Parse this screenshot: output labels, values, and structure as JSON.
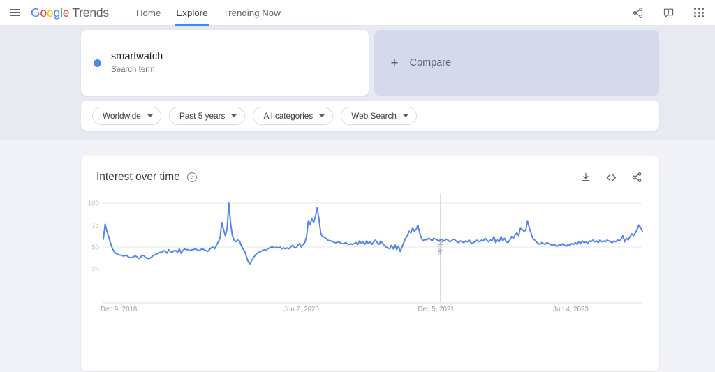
{
  "header": {
    "menu_icon": "hamburger-icon",
    "logo": {
      "g1": "G",
      "g2": "o",
      "g3": "o",
      "g4": "g",
      "g5": "l",
      "g6": "e",
      "product": "Trends"
    },
    "nav": [
      {
        "label": "Home",
        "active": false
      },
      {
        "label": "Explore",
        "active": true
      },
      {
        "label": "Trending Now",
        "active": false
      }
    ],
    "actions": [
      {
        "name": "share-icon",
        "label": "Share"
      },
      {
        "name": "feedback-icon",
        "label": "Send feedback"
      },
      {
        "name": "apps-grid-icon",
        "label": "Google apps"
      }
    ]
  },
  "terms": {
    "card": {
      "title": "smartwatch",
      "subtitle": "Search term",
      "color": "#5585ec"
    },
    "compare": {
      "label": "Compare",
      "icon": "plus-icon"
    }
  },
  "filters": [
    {
      "name": "location-filter",
      "label": "Worldwide"
    },
    {
      "name": "time-range-filter",
      "label": "Past 5 years"
    },
    {
      "name": "category-filter",
      "label": "All categories"
    },
    {
      "name": "search-type-filter",
      "label": "Web Search"
    }
  ],
  "interest_over_time": {
    "title": "Interest over time",
    "help": "?",
    "actions": [
      {
        "name": "download-icon",
        "label": "Download CSV"
      },
      {
        "name": "embed-code-icon",
        "label": "Embed"
      },
      {
        "name": "share-icon",
        "label": "Share"
      }
    ]
  },
  "chart_data": {
    "type": "line",
    "title": "Interest over time",
    "xlabel": "",
    "ylabel": "",
    "ylim": [
      0,
      100
    ],
    "yticks": [
      100,
      75,
      50,
      25
    ],
    "xticks": [
      "Dec 9, 2018",
      "Jun 7, 2020",
      "Dec 5, 2021",
      "Jun 4, 2023"
    ],
    "grid": true,
    "legend": false,
    "line_color": "#5585ec",
    "series_name": "smartwatch",
    "annotations": [
      {
        "label": "Note",
        "x_fraction": 0.625
      }
    ],
    "values": [
      59,
      76,
      68,
      62,
      55,
      49,
      45,
      43,
      42,
      41,
      41,
      40,
      40,
      41,
      39,
      38,
      38,
      39,
      40,
      39,
      37,
      38,
      41,
      40,
      38,
      37,
      37,
      38,
      40,
      41,
      42,
      43,
      44,
      44,
      46,
      45,
      43,
      47,
      45,
      44,
      46,
      46,
      44,
      48,
      43,
      46,
      48,
      47,
      47,
      46,
      47,
      47,
      48,
      47,
      46,
      47,
      48,
      47,
      46,
      45,
      47,
      49,
      50,
      48,
      52,
      56,
      60,
      78,
      70,
      63,
      70,
      100,
      77,
      63,
      58,
      56,
      58,
      57,
      52,
      48,
      45,
      39,
      33,
      31,
      35,
      38,
      41,
      43,
      44,
      45,
      46,
      47,
      46,
      48,
      49,
      50,
      50,
      49,
      50,
      49,
      50,
      48,
      49,
      48,
      49,
      48,
      50,
      52,
      50,
      49,
      52,
      54,
      50,
      53,
      55,
      62,
      80,
      76,
      82,
      78,
      85,
      95,
      82,
      66,
      62,
      61,
      60,
      58,
      57,
      57,
      56,
      55,
      55,
      56,
      55,
      54,
      54,
      55,
      54,
      53,
      54,
      53,
      54,
      55,
      53,
      57,
      54,
      56,
      53,
      57,
      54,
      56,
      53,
      56,
      58,
      55,
      53,
      57,
      54,
      52,
      50,
      49,
      48,
      52,
      48,
      53,
      47,
      51,
      45,
      50,
      55,
      60,
      63,
      68,
      66,
      72,
      68,
      70,
      75,
      66,
      60,
      57,
      59,
      58,
      60,
      59,
      57,
      60,
      59,
      58,
      57,
      59,
      58,
      57,
      59,
      58,
      56,
      57,
      59,
      58,
      56,
      55,
      57,
      56,
      55,
      57,
      56,
      58,
      55,
      54,
      56,
      58,
      57,
      56,
      58,
      57,
      60,
      58,
      56,
      58,
      57,
      62,
      55,
      58,
      56,
      62,
      57,
      60,
      56,
      55,
      58,
      62,
      60,
      64,
      66,
      63,
      72,
      70,
      68,
      69,
      80,
      72,
      66,
      60,
      58,
      56,
      54,
      53,
      55,
      54,
      53,
      55,
      54,
      53,
      52,
      53,
      52,
      51,
      53,
      52,
      54,
      52,
      51,
      53,
      52,
      54,
      53,
      55,
      53,
      56,
      54,
      57,
      55,
      56,
      54,
      57,
      56,
      58,
      56,
      57,
      55,
      58,
      56,
      57,
      56,
      58,
      57,
      56,
      55,
      57,
      56,
      58,
      57,
      59,
      63,
      56,
      60,
      58,
      62,
      65,
      63,
      66,
      70,
      75,
      72,
      68
    ]
  }
}
